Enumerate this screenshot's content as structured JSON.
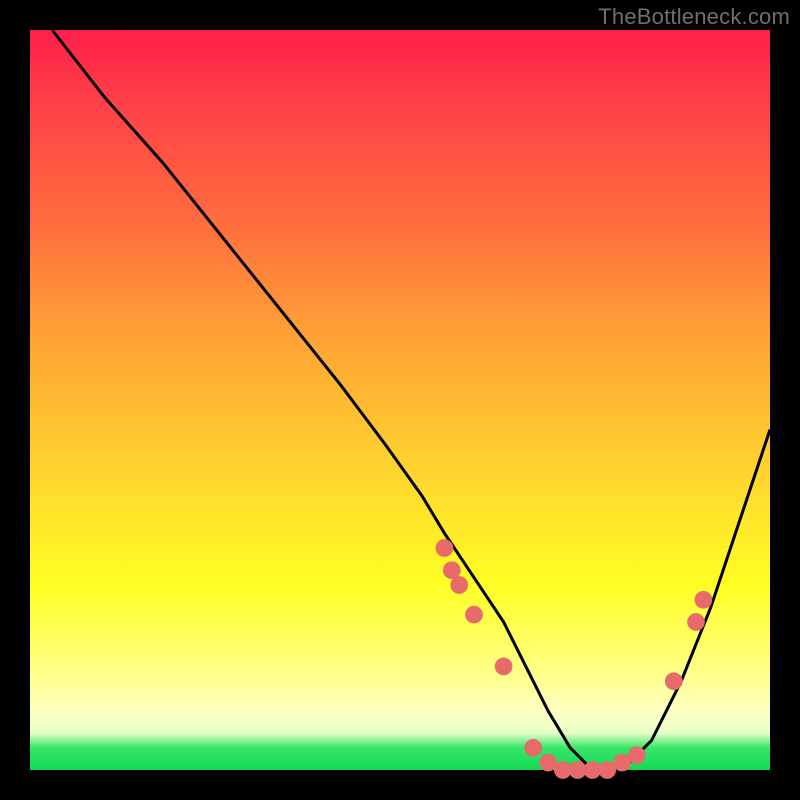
{
  "watermark": {
    "text": "TheBottleneck.com"
  },
  "chart_data": {
    "type": "line",
    "title": "",
    "xlabel": "",
    "ylabel": "",
    "xlim": [
      0,
      100
    ],
    "ylim": [
      0,
      100
    ],
    "legend": false,
    "grid": false,
    "background_gradient": [
      "#ff1f4a",
      "#ff6a3f",
      "#ffd52e",
      "#ffff24",
      "#ffffc2",
      "#15d953"
    ],
    "series": [
      {
        "name": "curve",
        "stroke": "#000000",
        "x": [
          3,
          10,
          18,
          26,
          34,
          42,
          48,
          53,
          56,
          60,
          64,
          67,
          70,
          73,
          76,
          80,
          84,
          88,
          92,
          96,
          100
        ],
        "y": [
          100,
          91,
          82,
          72,
          62,
          52,
          44,
          37,
          32,
          26,
          20,
          14,
          8,
          3,
          0,
          0,
          4,
          12,
          22,
          34,
          46
        ]
      }
    ],
    "points": [
      {
        "x": 56,
        "y": 30,
        "color": "#e86a6a"
      },
      {
        "x": 57,
        "y": 27,
        "color": "#e86a6a"
      },
      {
        "x": 58,
        "y": 25,
        "color": "#e86a6a"
      },
      {
        "x": 60,
        "y": 21,
        "color": "#e86a6a"
      },
      {
        "x": 64,
        "y": 14,
        "color": "#e86a6a"
      },
      {
        "x": 68,
        "y": 3,
        "color": "#e86a6a"
      },
      {
        "x": 70,
        "y": 1,
        "color": "#e86a6a"
      },
      {
        "x": 72,
        "y": 0,
        "color": "#e86a6a"
      },
      {
        "x": 74,
        "y": 0,
        "color": "#e86a6a"
      },
      {
        "x": 76,
        "y": 0,
        "color": "#e86a6a"
      },
      {
        "x": 78,
        "y": 0,
        "color": "#e86a6a"
      },
      {
        "x": 80,
        "y": 1,
        "color": "#e86a6a"
      },
      {
        "x": 82,
        "y": 2,
        "color": "#e86a6a"
      },
      {
        "x": 87,
        "y": 12,
        "color": "#e86a6a"
      },
      {
        "x": 90,
        "y": 20,
        "color": "#e86a6a"
      },
      {
        "x": 91,
        "y": 23,
        "color": "#e86a6a"
      }
    ]
  }
}
